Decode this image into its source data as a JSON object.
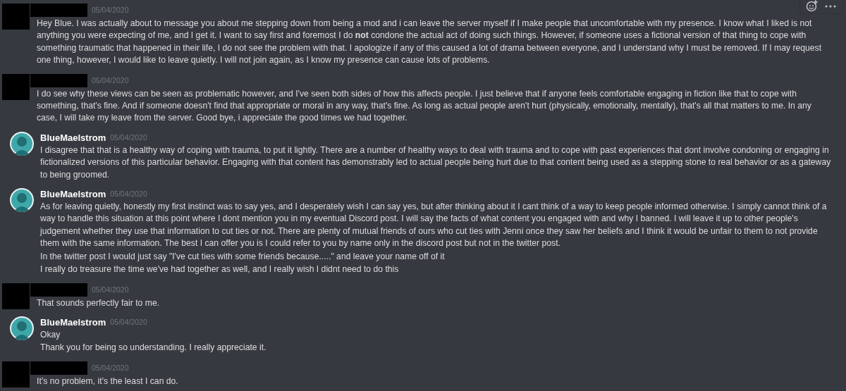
{
  "toolbar": {
    "visible": true
  },
  "messages": [
    {
      "author": {
        "kind": "redacted"
      },
      "timestamp": "05/04/2020",
      "paragraphs": [
        "Hey Blue. I was actually about to message you about me stepping down from being a mod and i can leave the server myself if I make people that uncomfortable with my presence. I know what I liked is not anything you were expecting of me, and I get it. I want to say first and foremost I do **not** condone the actual act of doing such things. However, if someone uses a fictional version of that thing to cope with something traumatic that happened in their life, I do not see the problem with that. I apologize if any of this caused a lot of drama between everyone, and I understand why I must be removed. If I may request one thing, however, I would like to leave quietly. I will not join again, as I know my presence can cause lots of problems."
      ]
    },
    {
      "author": {
        "kind": "redacted"
      },
      "timestamp": "05/04/2020",
      "paragraphs": [
        "I do see why these views can be seen as problematic however, and I've seen both sides of how this affects people. I just believe that if anyone feels comfortable engaging in fiction like that to cope with something, that's fine. And if someone doesn't find that appropriate or moral in any way, that's fine. As long as actual people aren't hurt (physically, emotionally, mentally), that's all that matters to me. In any case, I will take my leave from the server. Good bye, i appreciate the good times we had together."
      ]
    },
    {
      "author": {
        "kind": "user",
        "name": "BlueMaelstrom"
      },
      "timestamp": "05/04/2020",
      "paragraphs": [
        "I disagree that that is a healthy way of coping with trauma, to put it lightly. There are a number of healthy ways to deal with trauma and to cope with past experiences that dont involve condoning or engaging in fictionalized versions of this particular behavior. Engaging with that content has demonstrably led to actual people being hurt due to that content being used as a stepping stone to real behavior or as a gateway to being groomed."
      ]
    },
    {
      "author": {
        "kind": "user",
        "name": "BlueMaelstrom"
      },
      "timestamp": "05/04/2020",
      "paragraphs": [
        "As for leaving quietly, honestly my first instinct was to say yes, and I desperately wish I can say yes, but after thinking about it I cant think of a way to keep people informed otherwise. I simply cannot think of a way to handle this situation at this point where I dont mention you in my eventual Discord post. I will say the facts of what content you engaged with and why I banned. I will leave it up to other people's judgement whether they use that information to cut ties or not. There are plenty of mutual friends of ours who cut ties with Jenni once they saw her beliefs and I think it would be unfair to them to not provide them with the same information. The best I can offer you is I could refer to you by name only in the discord post but not in the twitter post.",
        "In the twitter post I would just say \"I've cut ties with some friends because.....\" and leave your name off of it",
        "I really do treasure the time we've had together as well, and I really wish I didnt need to do this"
      ]
    },
    {
      "author": {
        "kind": "redacted"
      },
      "timestamp": "05/04/2020",
      "paragraphs": [
        "That sounds perfectly fair to me."
      ]
    },
    {
      "author": {
        "kind": "user",
        "name": "BlueMaelstrom"
      },
      "timestamp": "05/04/2020",
      "paragraphs": [
        "Okay",
        "Thank you for being so understanding. I really appreciate it."
      ]
    },
    {
      "author": {
        "kind": "redacted"
      },
      "timestamp": "05/04/2020",
      "paragraphs": [
        "It’s no problem, it’s the least I can do."
      ]
    }
  ]
}
